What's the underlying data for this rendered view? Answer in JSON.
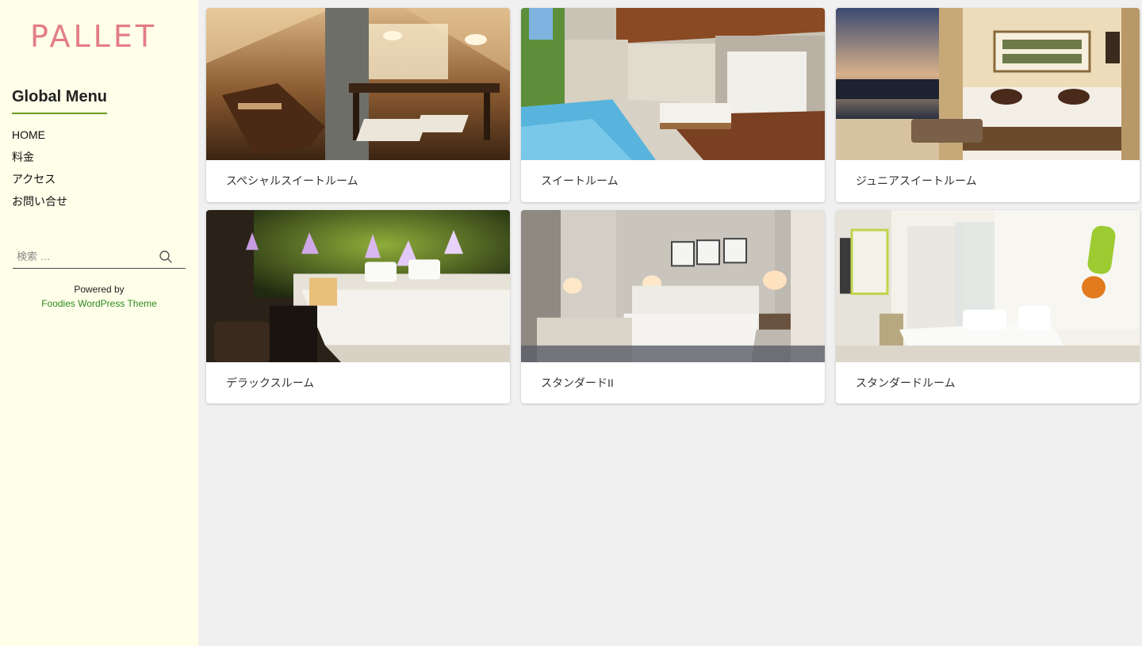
{
  "sidebar": {
    "logo": "PALLET",
    "menu_title": "Global Menu",
    "menu_items": [
      {
        "label": "HOME"
      },
      {
        "label": "料金"
      },
      {
        "label": "アクセス"
      },
      {
        "label": "お問い合せ"
      }
    ],
    "search": {
      "placeholder": "検索 …",
      "icon": "search-icon"
    },
    "powered_by": "Powered by",
    "theme_link": "Foodies WordPress Theme"
  },
  "rooms": [
    {
      "title": "スペシャルスイートルーム"
    },
    {
      "title": "スイートルーム"
    },
    {
      "title": "ジュニアスイートルーム"
    },
    {
      "title": "デラックスルーム"
    },
    {
      "title": "スタンダードII"
    },
    {
      "title": "スタンダードルーム"
    }
  ],
  "colors": {
    "sidebar_bg": "#fefee9",
    "logo": "#e37d86",
    "accent": "#6f9a1e",
    "link": "#2f8a1d",
    "page_bg": "#f0f0f0"
  }
}
